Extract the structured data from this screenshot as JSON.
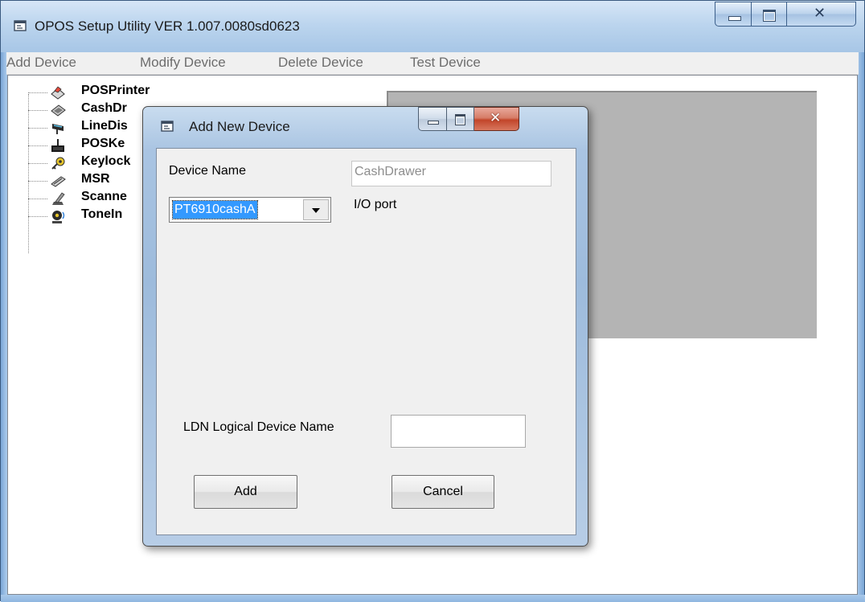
{
  "main_window": {
    "title": "OPOS Setup Utility VER 1.007.0080sd0623",
    "icon": "app-window-icon",
    "caption_buttons": [
      "minimize-icon",
      "maximize-icon",
      "close-icon"
    ]
  },
  "menubar": {
    "items": [
      "Add Device",
      "Modify Device",
      "Delete Device",
      "Test Device"
    ]
  },
  "tree": {
    "items": [
      {
        "label": "POSPrinter",
        "icon": "printer-icon"
      },
      {
        "label": "CashDr",
        "icon": "cash-drawer-icon"
      },
      {
        "label": "LineDis",
        "icon": "line-display-icon"
      },
      {
        "label": "POSKe",
        "icon": "pos-keyboard-icon"
      },
      {
        "label": "Keylock",
        "icon": "keylock-icon"
      },
      {
        "label": "MSR",
        "icon": "msr-icon"
      },
      {
        "label": "Scanne",
        "icon": "scanner-icon"
      },
      {
        "label": "ToneIn",
        "icon": "tone-indicator-icon"
      }
    ]
  },
  "dialog": {
    "title": "Add New Device",
    "device_name_label": "Device Name",
    "device_name_selected": "PT6910cashA",
    "device_class_value": "CashDrawer",
    "io_port_label": "I/O port",
    "ldn_label": "LDN Logical Device Name",
    "ldn_value": "",
    "add_label": "Add",
    "cancel_label": "Cancel"
  },
  "colors": {
    "selection": "#3399ff",
    "title_gradient_top": "#d6e6f7",
    "dialog_close": "#c2452a",
    "panel_gray": "#b4b4b4"
  }
}
